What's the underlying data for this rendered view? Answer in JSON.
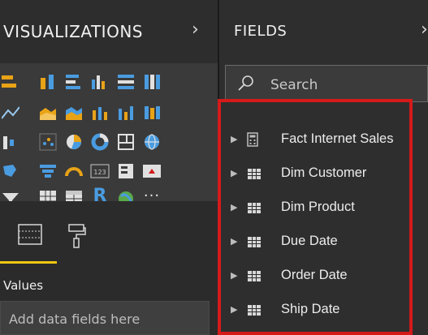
{
  "visualizations": {
    "title": "VISUALIZATIONS",
    "chevron": "›",
    "gallery_icons": [
      "stacked-bar-icon",
      "stacked-column-icon",
      "clustered-bar-icon",
      "clustered-column-icon",
      "100-stacked-bar-icon",
      "100-stacked-column-icon",
      "line-chart-icon",
      "area-chart-icon",
      "stacked-area-icon",
      "line-column-icon",
      "line-clustered-column-icon",
      "ribbon-chart-icon",
      "waterfall-icon",
      "scatter-icon",
      "pie-chart-icon",
      "donut-chart-icon",
      "treemap-icon",
      "map-icon",
      "filled-map-icon",
      "funnel-icon",
      "gauge-icon",
      "card-icon",
      "multi-row-card-icon",
      "kpi-icon",
      "slicer-icon",
      "table-icon",
      "matrix-icon",
      "r-visual-icon",
      "globe-icon",
      "more-icon"
    ],
    "r_label": "R",
    "more_label": "···",
    "values_label": "Values",
    "add_placeholder": "Add data fields here"
  },
  "fields": {
    "title": "FIELDS",
    "chevron": "›",
    "search_placeholder": "Search",
    "tables": [
      {
        "label": "Fact Internet Sales",
        "icon": "calculator-table-icon"
      },
      {
        "label": "Dim Customer",
        "icon": "table-icon"
      },
      {
        "label": "Dim Product",
        "icon": "table-icon"
      },
      {
        "label": "Due Date",
        "icon": "table-icon"
      },
      {
        "label": "Order Date",
        "icon": "table-icon"
      },
      {
        "label": "Ship Date",
        "icon": "table-icon"
      }
    ],
    "highlight_color": "#d51a1a"
  },
  "colors": {
    "accent": "#f2c811",
    "chart_blue": "#4a9ce0",
    "chart_orange": "#e8a317"
  }
}
